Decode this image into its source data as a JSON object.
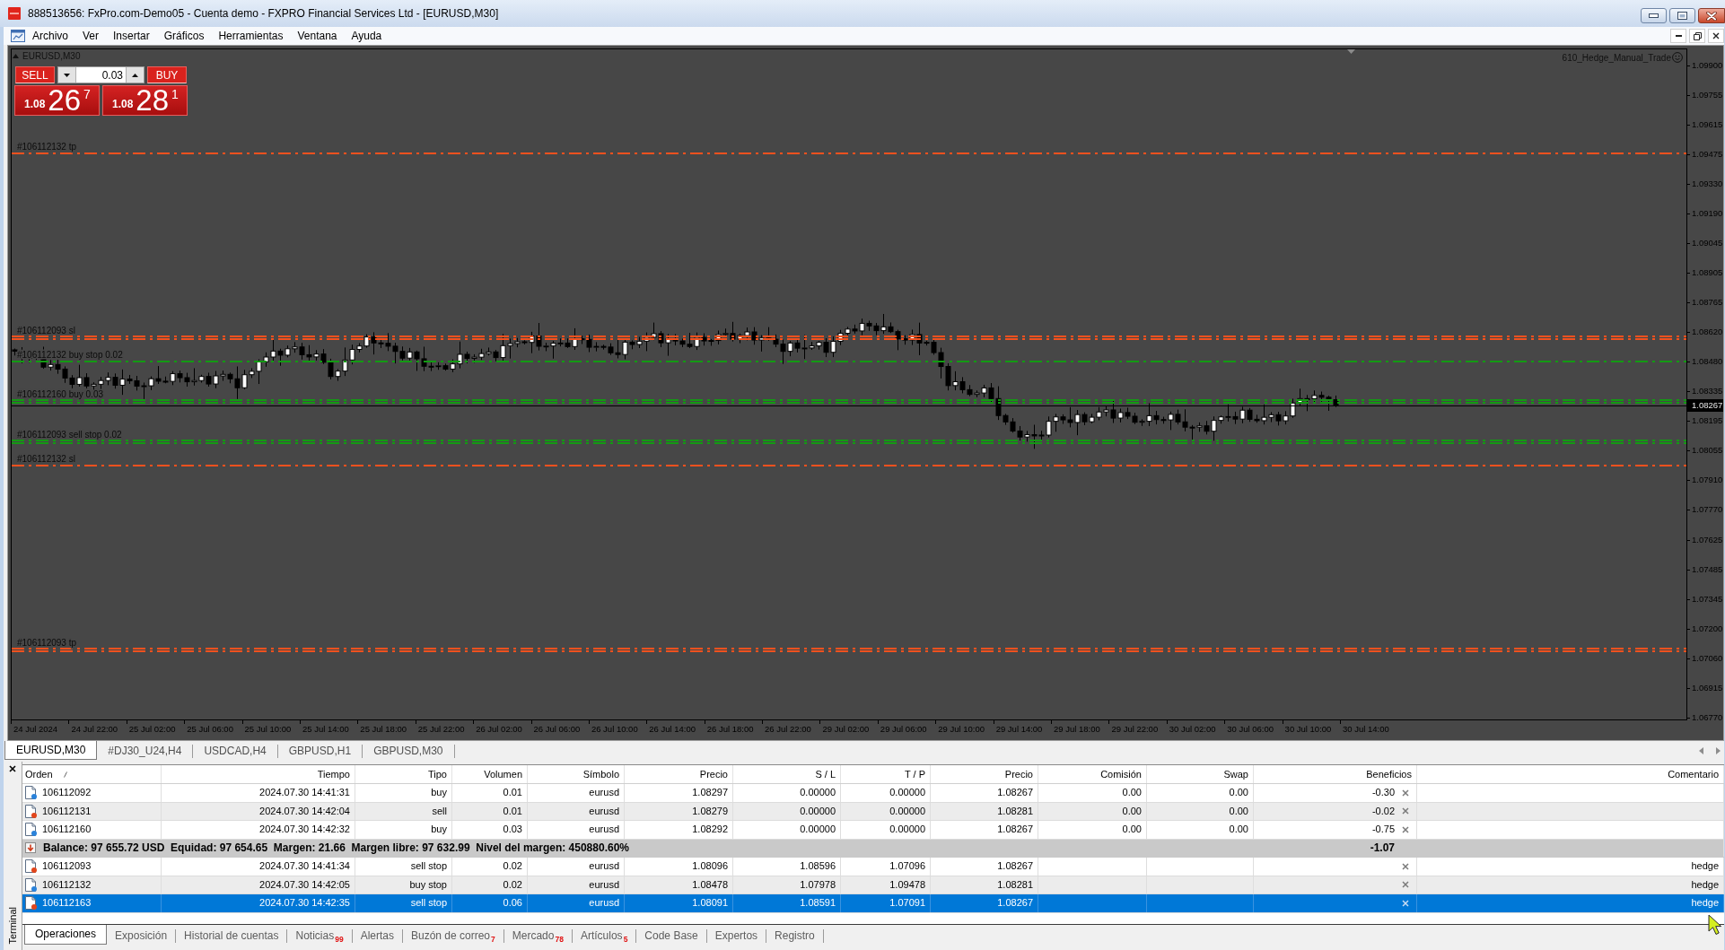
{
  "window": {
    "title": "888513656: FxPro.com-Demo05 - Cuenta demo - FXPRO Financial Services Ltd - [EURUSD,M30]"
  },
  "menu": [
    "Archivo",
    "Ver",
    "Insertar",
    "Gráficos",
    "Herramientas",
    "Ventana",
    "Ayuda"
  ],
  "chart": {
    "symbol_label": "EURUSD,M30",
    "trade_panel": {
      "sell_label": "SELL",
      "lot": "0.03",
      "buy_label": "BUY",
      "sell_price": {
        "prefix": "1.08",
        "big": "26",
        "pip": "7"
      },
      "buy_price": {
        "prefix": "1.08",
        "big": "28",
        "pip": "1"
      }
    },
    "expert_label": "610_Hedge_Manual_Trade",
    "order_lines": [
      {
        "label": "#106112132 tp",
        "color": "#f4511e",
        "kind": "single"
      },
      {
        "label": "#106112093 sl",
        "color": "#f4511e",
        "kind": "double"
      },
      {
        "label": "#106112132 buy stop 0.02",
        "color": "#139a13",
        "kind": "single"
      },
      {
        "label": "#106112160 buy 0.03",
        "color": "#139a13",
        "kind": "double"
      },
      {
        "label": "#106112093 sell stop 0.02",
        "color": "#139a13",
        "kind": "double"
      },
      {
        "label": "#106112132 sl",
        "color": "#f4511e",
        "kind": "single"
      },
      {
        "label": "#106112093 tp",
        "color": "#f4511e",
        "kind": "double"
      }
    ],
    "price_axis": [
      "1.09900",
      "1.09755",
      "1.09615",
      "1.09475",
      "1.09330",
      "1.09190",
      "1.09045",
      "1.08905",
      "1.08765",
      "1.08620",
      "1.08480",
      "1.08335",
      "1.08195",
      "1.08055",
      "1.07910",
      "1.07770",
      "1.07625",
      "1.07485",
      "1.07345",
      "1.07200",
      "1.07060",
      "1.06915",
      "1.06770"
    ],
    "current_price": "1.08267",
    "time_axis": [
      "24 Jul 2024",
      "24 Jul 22:00",
      "25 Jul 02:00",
      "25 Jul 06:00",
      "25 Jul 10:00",
      "25 Jul 14:00",
      "25 Jul 18:00",
      "25 Jul 22:00",
      "26 Jul 02:00",
      "26 Jul 06:00",
      "26 Jul 10:00",
      "26 Jul 14:00",
      "26 Jul 18:00",
      "26 Jul 22:00",
      "29 Jul 02:00",
      "29 Jul 06:00",
      "29 Jul 10:00",
      "29 Jul 14:00",
      "29 Jul 18:00",
      "29 Jul 22:00",
      "30 Jul 02:00",
      "30 Jul 06:00",
      "30 Jul 10:00",
      "30 Jul 14:00"
    ]
  },
  "chart_tabs": [
    {
      "label": "EURUSD,M30",
      "selected": true
    },
    {
      "label": "#DJ30_U24,H4",
      "selected": false
    },
    {
      "label": "USDCAD,H4",
      "selected": false
    },
    {
      "label": "GBPUSD,H1",
      "selected": false
    },
    {
      "label": "GBPUSD,M30",
      "selected": false
    }
  ],
  "terminal": {
    "title": "Terminal",
    "columns": [
      "Orden",
      "Tiempo",
      "Tipo",
      "Volumen",
      "Símbolo",
      "Precio",
      "S / L",
      "T / P",
      "Precio",
      "Comisión",
      "Swap",
      "Beneficios",
      "Comentario"
    ],
    "rows": [
      {
        "kind": "trade",
        "order": "106112092",
        "time": "2024.07.30 14:41:31",
        "type": "buy",
        "volume": "0.01",
        "symbol": "eurusd",
        "open_price": "1.08297",
        "sl": "0.00000",
        "tp": "0.00000",
        "price": "1.08267",
        "commission": "0.00",
        "swap": "0.00",
        "profit": "-0.30",
        "color": "#2a82da",
        "selected": false
      },
      {
        "kind": "trade",
        "order": "106112131",
        "time": "2024.07.30 14:42:04",
        "type": "sell",
        "volume": "0.01",
        "symbol": "eurusd",
        "open_price": "1.08279",
        "sl": "0.00000",
        "tp": "0.00000",
        "price": "1.08281",
        "commission": "0.00",
        "swap": "0.00",
        "profit": "-0.02",
        "color": "#e2461c",
        "selected": false
      },
      {
        "kind": "trade",
        "order": "106112160",
        "time": "2024.07.30 14:42:32",
        "type": "buy",
        "volume": "0.03",
        "symbol": "eurusd",
        "open_price": "1.08292",
        "sl": "0.00000",
        "tp": "0.00000",
        "price": "1.08267",
        "commission": "0.00",
        "swap": "0.00",
        "profit": "-0.75",
        "color": "#2a82da",
        "selected": false
      },
      {
        "kind": "summary",
        "text": "Balance: 97 655.72 USD  Equidad: 97 654.65  Margen: 21.66  Margen libre: 97 632.99  Nivel del margen: 450880.60%",
        "profit": "-1.07",
        "selected": false
      },
      {
        "kind": "trade",
        "order": "106112093",
        "time": "2024.07.30 14:41:34",
        "type": "sell stop",
        "volume": "0.02",
        "symbol": "eurusd",
        "open_price": "1.08096",
        "sl": "1.08596",
        "tp": "1.07096",
        "price": "1.08267",
        "comment": "hedge",
        "color": "#e2461c",
        "selected": false
      },
      {
        "kind": "trade",
        "order": "106112132",
        "time": "2024.07.30 14:42:05",
        "type": "buy stop",
        "volume": "0.02",
        "symbol": "eurusd",
        "open_price": "1.08478",
        "sl": "1.07978",
        "tp": "1.09478",
        "price": "1.08281",
        "comment": "hedge",
        "color": "#2a82da",
        "selected": false
      },
      {
        "kind": "trade",
        "order": "106112163",
        "time": "2024.07.30 14:42:35",
        "type": "sell stop",
        "volume": "0.06",
        "symbol": "eurusd",
        "open_price": "1.08091",
        "sl": "1.08591",
        "tp": "1.07091",
        "price": "1.08267",
        "comment": "hedge",
        "color": "#e2461c",
        "selected": true
      }
    ],
    "tabs": [
      {
        "label": "Operaciones",
        "selected": true
      },
      {
        "label": "Exposición",
        "selected": false
      },
      {
        "label": "Historial de cuentas",
        "selected": false
      },
      {
        "label": "Noticias",
        "badge": "99",
        "selected": false
      },
      {
        "label": "Alertas",
        "selected": false
      },
      {
        "label": "Buzón de correo",
        "badge": "7",
        "selected": false
      },
      {
        "label": "Mercado",
        "badge": "78",
        "selected": false
      },
      {
        "label": "Artículos",
        "badge": "5",
        "selected": false
      },
      {
        "label": "Code Base",
        "selected": false
      },
      {
        "label": "Expertos",
        "selected": false
      },
      {
        "label": "Registro",
        "selected": false
      }
    ]
  }
}
